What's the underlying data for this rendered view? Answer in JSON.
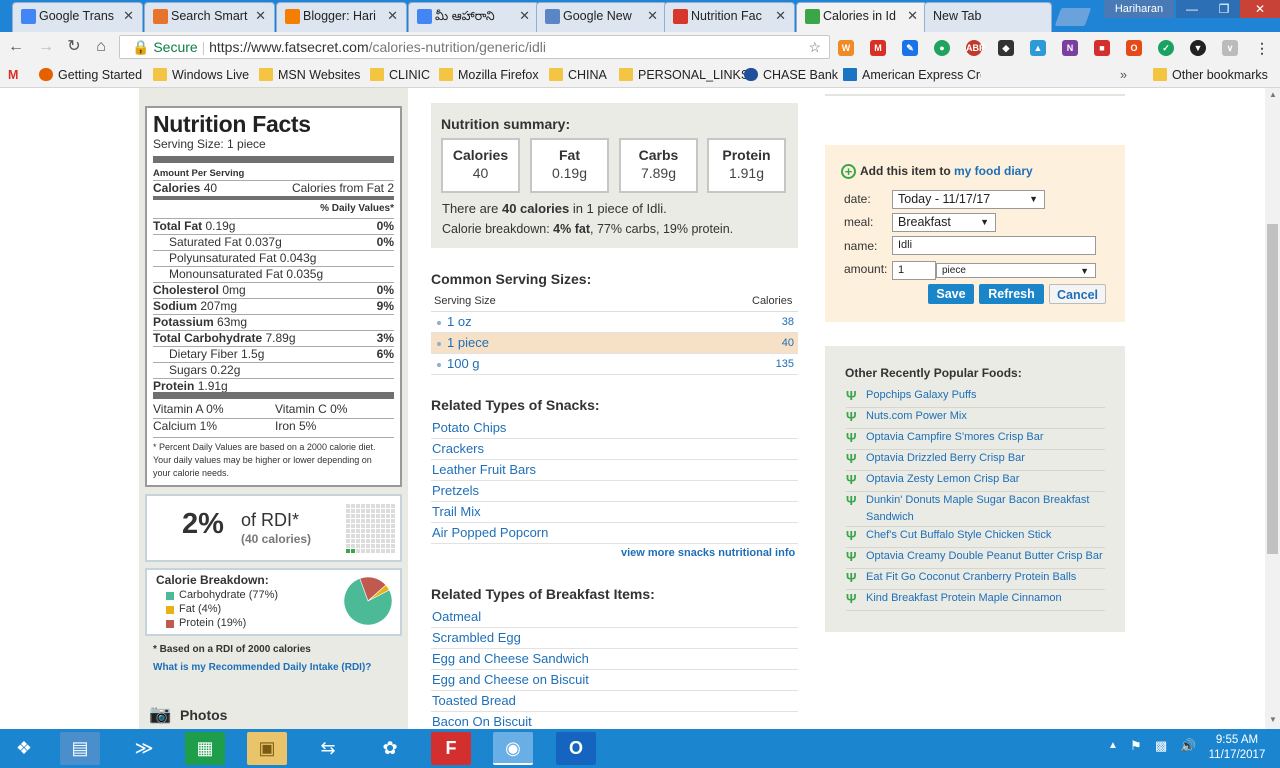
{
  "tabs": [
    {
      "title": "Google Trans",
      "icon": "google-translate-icon",
      "color": "#4285f4"
    },
    {
      "title": "Search Smart",
      "icon": "sun-icon",
      "color": "#e8732a"
    },
    {
      "title": "Blogger: Hari",
      "icon": "blogger-icon",
      "color": "#f57d00"
    },
    {
      "title": "మీ ఆహారాని",
      "icon": "google-docs-icon",
      "color": "#4285f4"
    },
    {
      "title": "Google New",
      "icon": "google-news-icon",
      "color": "#5a86c5"
    },
    {
      "title": "Nutrition Fac",
      "icon": "sf-icon",
      "color": "#d6362b"
    },
    {
      "title": "Calories in Id",
      "icon": "fatsecret-icon",
      "color": "#3aa648"
    },
    {
      "title": "New Tab",
      "icon": "",
      "color": ""
    }
  ],
  "profile": "Hariharan",
  "omnibox": {
    "secure": "Secure",
    "url_host": "https://www.fatsecret.com",
    "url_path": "/calories-nutrition/generic/idli"
  },
  "bookmarks": [
    "Getting Started",
    "Windows Live",
    "MSN Websites",
    "CLINIC",
    "Mozilla Firefox",
    "CHINA",
    "PERSONAL_LINKS",
    "CHASE Bank",
    "American Express Cre",
    "Other bookmarks"
  ],
  "nutrition": {
    "title": "Nutrition Facts",
    "serving": "Serving Size: 1 piece",
    "amount_per": "Amount Per Serving",
    "calories_label": "Calories",
    "calories_value": "40",
    "calories_fat": "Calories from Fat 2",
    "dv_header": "% Daily Values*",
    "rows": [
      {
        "label": "Total Fat",
        "value": "0.19g",
        "pct": "0%",
        "bold": true
      },
      {
        "label": "Saturated Fat",
        "value": "0.037g",
        "pct": "0%",
        "bold": false
      },
      {
        "label": "Polyunsaturated Fat",
        "value": "0.043g",
        "pct": "",
        "bold": false
      },
      {
        "label": "Monounsaturated Fat",
        "value": "0.035g",
        "pct": "",
        "bold": false
      },
      {
        "label": "Cholesterol",
        "value": "0mg",
        "pct": "0%",
        "bold": true
      },
      {
        "label": "Sodium",
        "value": "207mg",
        "pct": "9%",
        "bold": true
      },
      {
        "label": "Potassium",
        "value": "63mg",
        "pct": "",
        "bold": true
      },
      {
        "label": "Total Carbohydrate",
        "value": "7.89g",
        "pct": "3%",
        "bold": true
      },
      {
        "label": "Dietary Fiber",
        "value": "1.5g",
        "pct": "6%",
        "bold": false
      },
      {
        "label": "Sugars",
        "value": "0.22g",
        "pct": "",
        "bold": false
      },
      {
        "label": "Protein",
        "value": "1.91g",
        "pct": "",
        "bold": true
      }
    ],
    "vitamins": [
      [
        "Vitamin A 0%",
        "Vitamin C 0%"
      ],
      [
        "Calcium 1%",
        "Iron 5%"
      ]
    ],
    "footnote": "* Percent Daily Values are based on a 2000 calorie diet. Your daily values may be higher or lower depending on your calorie needs."
  },
  "rdi": {
    "pct": "2%",
    "label": "of RDI*",
    "sub": "(40 calories)",
    "fraction": 0.02
  },
  "breakdown": {
    "title": "Calorie Breakdown:",
    "items": [
      {
        "label": "Carbohydrate (77%)",
        "color": "#4dba97",
        "value": 77
      },
      {
        "label": "Fat (4%)",
        "color": "#e8b116",
        "value": 4
      },
      {
        "label": "Protein (19%)",
        "color": "#c05a4f",
        "value": 19
      }
    ],
    "note": "* Based on a RDI of 2000 calories",
    "link": "What is my Recommended Daily Intake (RDI)?"
  },
  "photos": "Photos",
  "summary": {
    "title": "Nutrition summary:",
    "boxes": [
      {
        "h": "Calories",
        "v": "40"
      },
      {
        "h": "Fat",
        "v": "0.19g"
      },
      {
        "h": "Carbs",
        "v": "7.89g"
      },
      {
        "h": "Protein",
        "v": "1.91g"
      }
    ],
    "line1_a": "There are ",
    "line1_b": "40 calories",
    "line1_c": " in 1 piece of Idli.",
    "line2_a": "Calorie breakdown: ",
    "line2_b": "4% fat",
    "line2_c": ", 77% carbs, 19% protein."
  },
  "servings": {
    "title": "Common Serving Sizes:",
    "col1": "Serving Size",
    "col2": "Calories",
    "rows": [
      {
        "size": "1 oz",
        "cal": "38"
      },
      {
        "size": "1 piece",
        "cal": "40"
      },
      {
        "size": "100 g",
        "cal": "135"
      }
    ]
  },
  "snacks": {
    "title": "Related Types of Snacks:",
    "items": [
      "Potato Chips",
      "Crackers",
      "Leather Fruit Bars",
      "Pretzels",
      "Trail Mix",
      "Air Popped Popcorn"
    ],
    "more": "view more snacks nutritional info"
  },
  "breakfast": {
    "title": "Related Types of Breakfast Items:",
    "items": [
      "Oatmeal",
      "Scrambled Egg",
      "Egg and Cheese Sandwich",
      "Egg and Cheese on Biscuit",
      "Toasted Bread",
      "Bacon On Biscuit"
    ]
  },
  "diary": {
    "add_a": "Add this item to ",
    "add_link": "my food diary",
    "date_label": "date:",
    "date_value": "Today - 11/17/17",
    "meal_label": "meal:",
    "meal_value": "Breakfast",
    "name_label": "name:",
    "name_value": "Idli",
    "amount_label": "amount:",
    "amount_value": "1",
    "unit_value": "piece",
    "save": "Save",
    "refresh": "Refresh",
    "cancel": "Cancel"
  },
  "popular": {
    "title": "Other Recently Popular Foods:",
    "items": [
      "Popchips Galaxy Puffs",
      "Nuts.com Power Mix",
      "Optavia Campfire S'mores Crisp Bar",
      "Optavia Drizzled Berry Crisp Bar",
      "Optavia Zesty Lemon Crisp Bar",
      "Dunkin' Donuts Maple Sugar Bacon Breakfast Sandwich",
      "Chef's Cut Buffalo Style Chicken Stick",
      "Optavia Creamy Double Peanut Butter Crisp Bar",
      "Eat Fit Go Coconut Cranberry Protein Balls",
      "Kind Breakfast Protein Maple Cinnamon"
    ]
  },
  "clock": {
    "time": "9:55 AM",
    "date": "11/17/2017"
  }
}
